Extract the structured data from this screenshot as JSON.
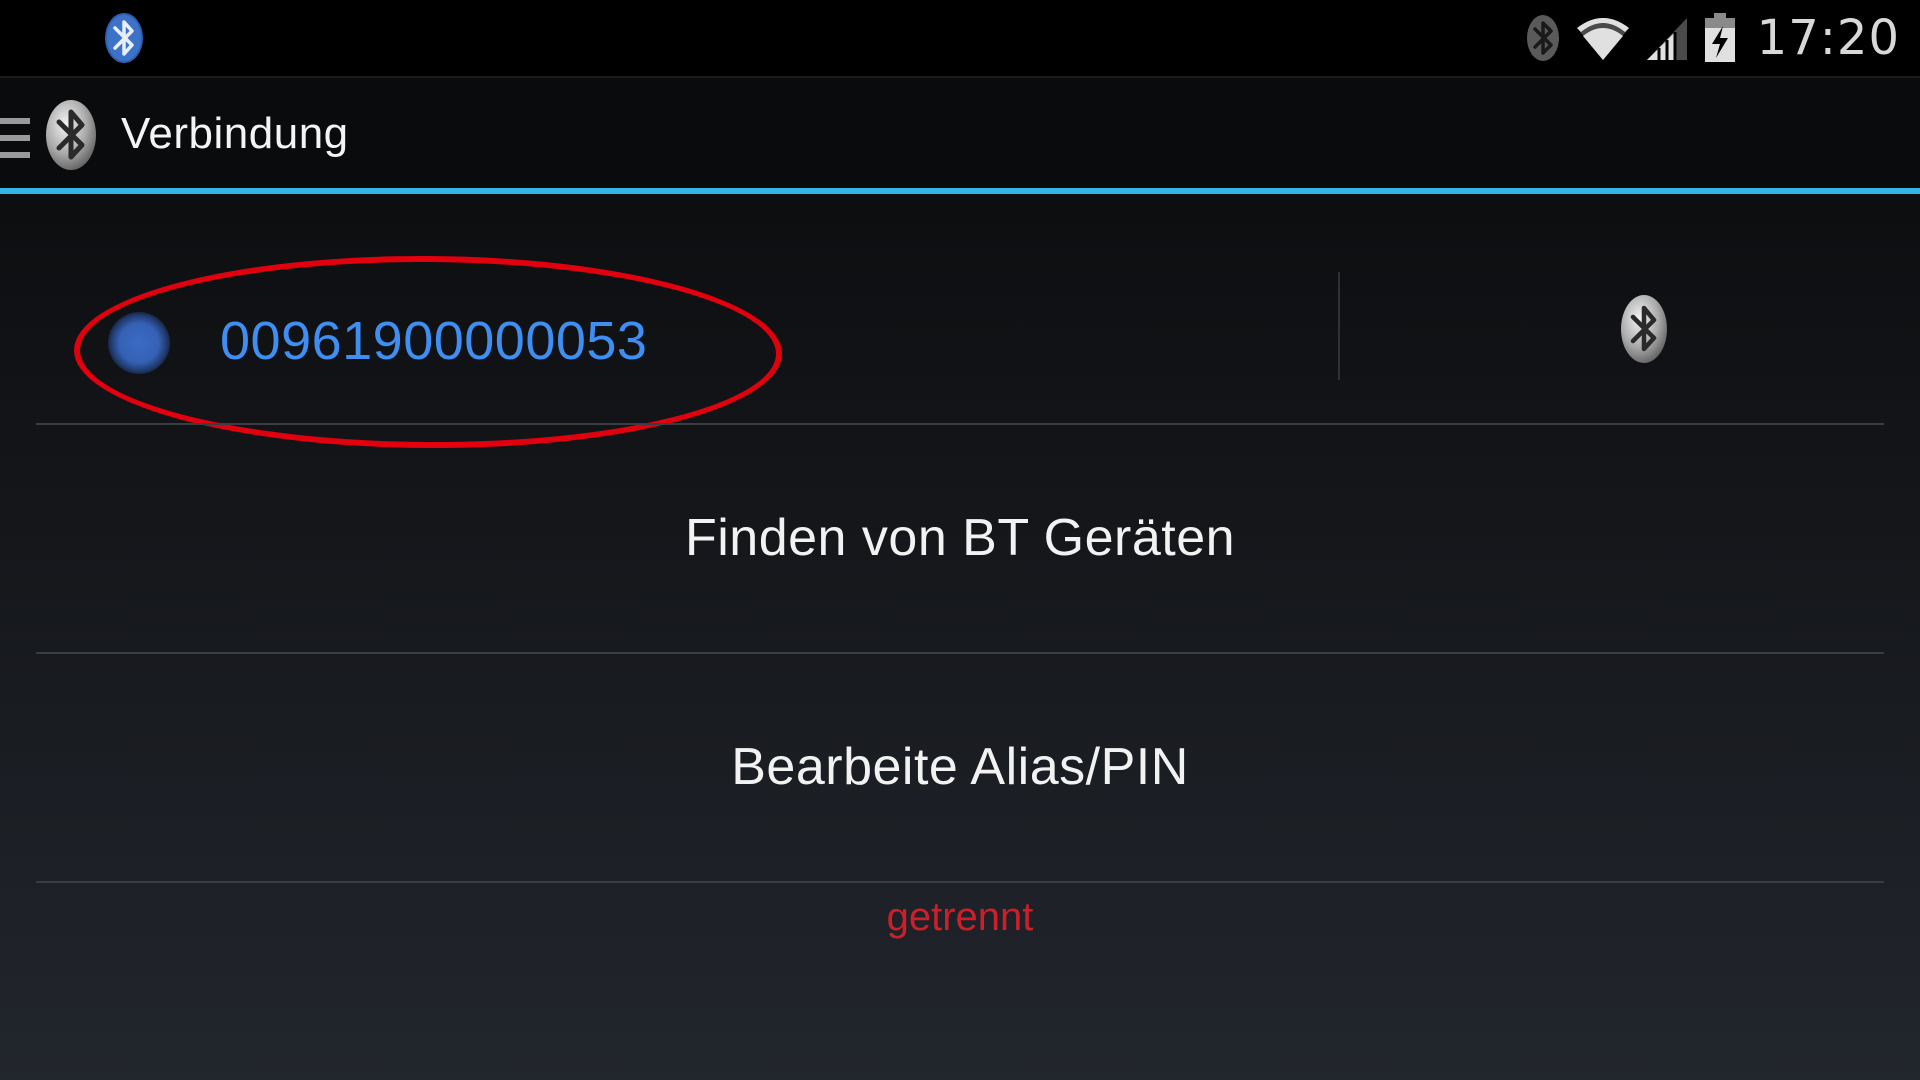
{
  "status_bar": {
    "notification_icon": "bluetooth-app-icon",
    "icons": [
      "bluetooth-icon",
      "wifi-icon",
      "signal-icon",
      "battery-charging-icon"
    ],
    "time": "17:20"
  },
  "action_bar": {
    "drawer_icon": "drawer-menu-icon",
    "app_icon": "bluetooth-app-icon",
    "title": "Verbindung",
    "accent_color": "#33b5e5"
  },
  "device": {
    "id": "00961900000053",
    "id_color": "#3f8ef2",
    "status_dot_color": "#3561b5",
    "connect_icon": "bluetooth-icon"
  },
  "menu": {
    "find_devices_label": "Finden von BT Geräten",
    "edit_alias_label": "Bearbeite Alias/PIN"
  },
  "connection": {
    "status_text": "getrennt",
    "status_color": "#cc1f2a"
  },
  "annotation": {
    "highlight_color": "#e0000e"
  }
}
